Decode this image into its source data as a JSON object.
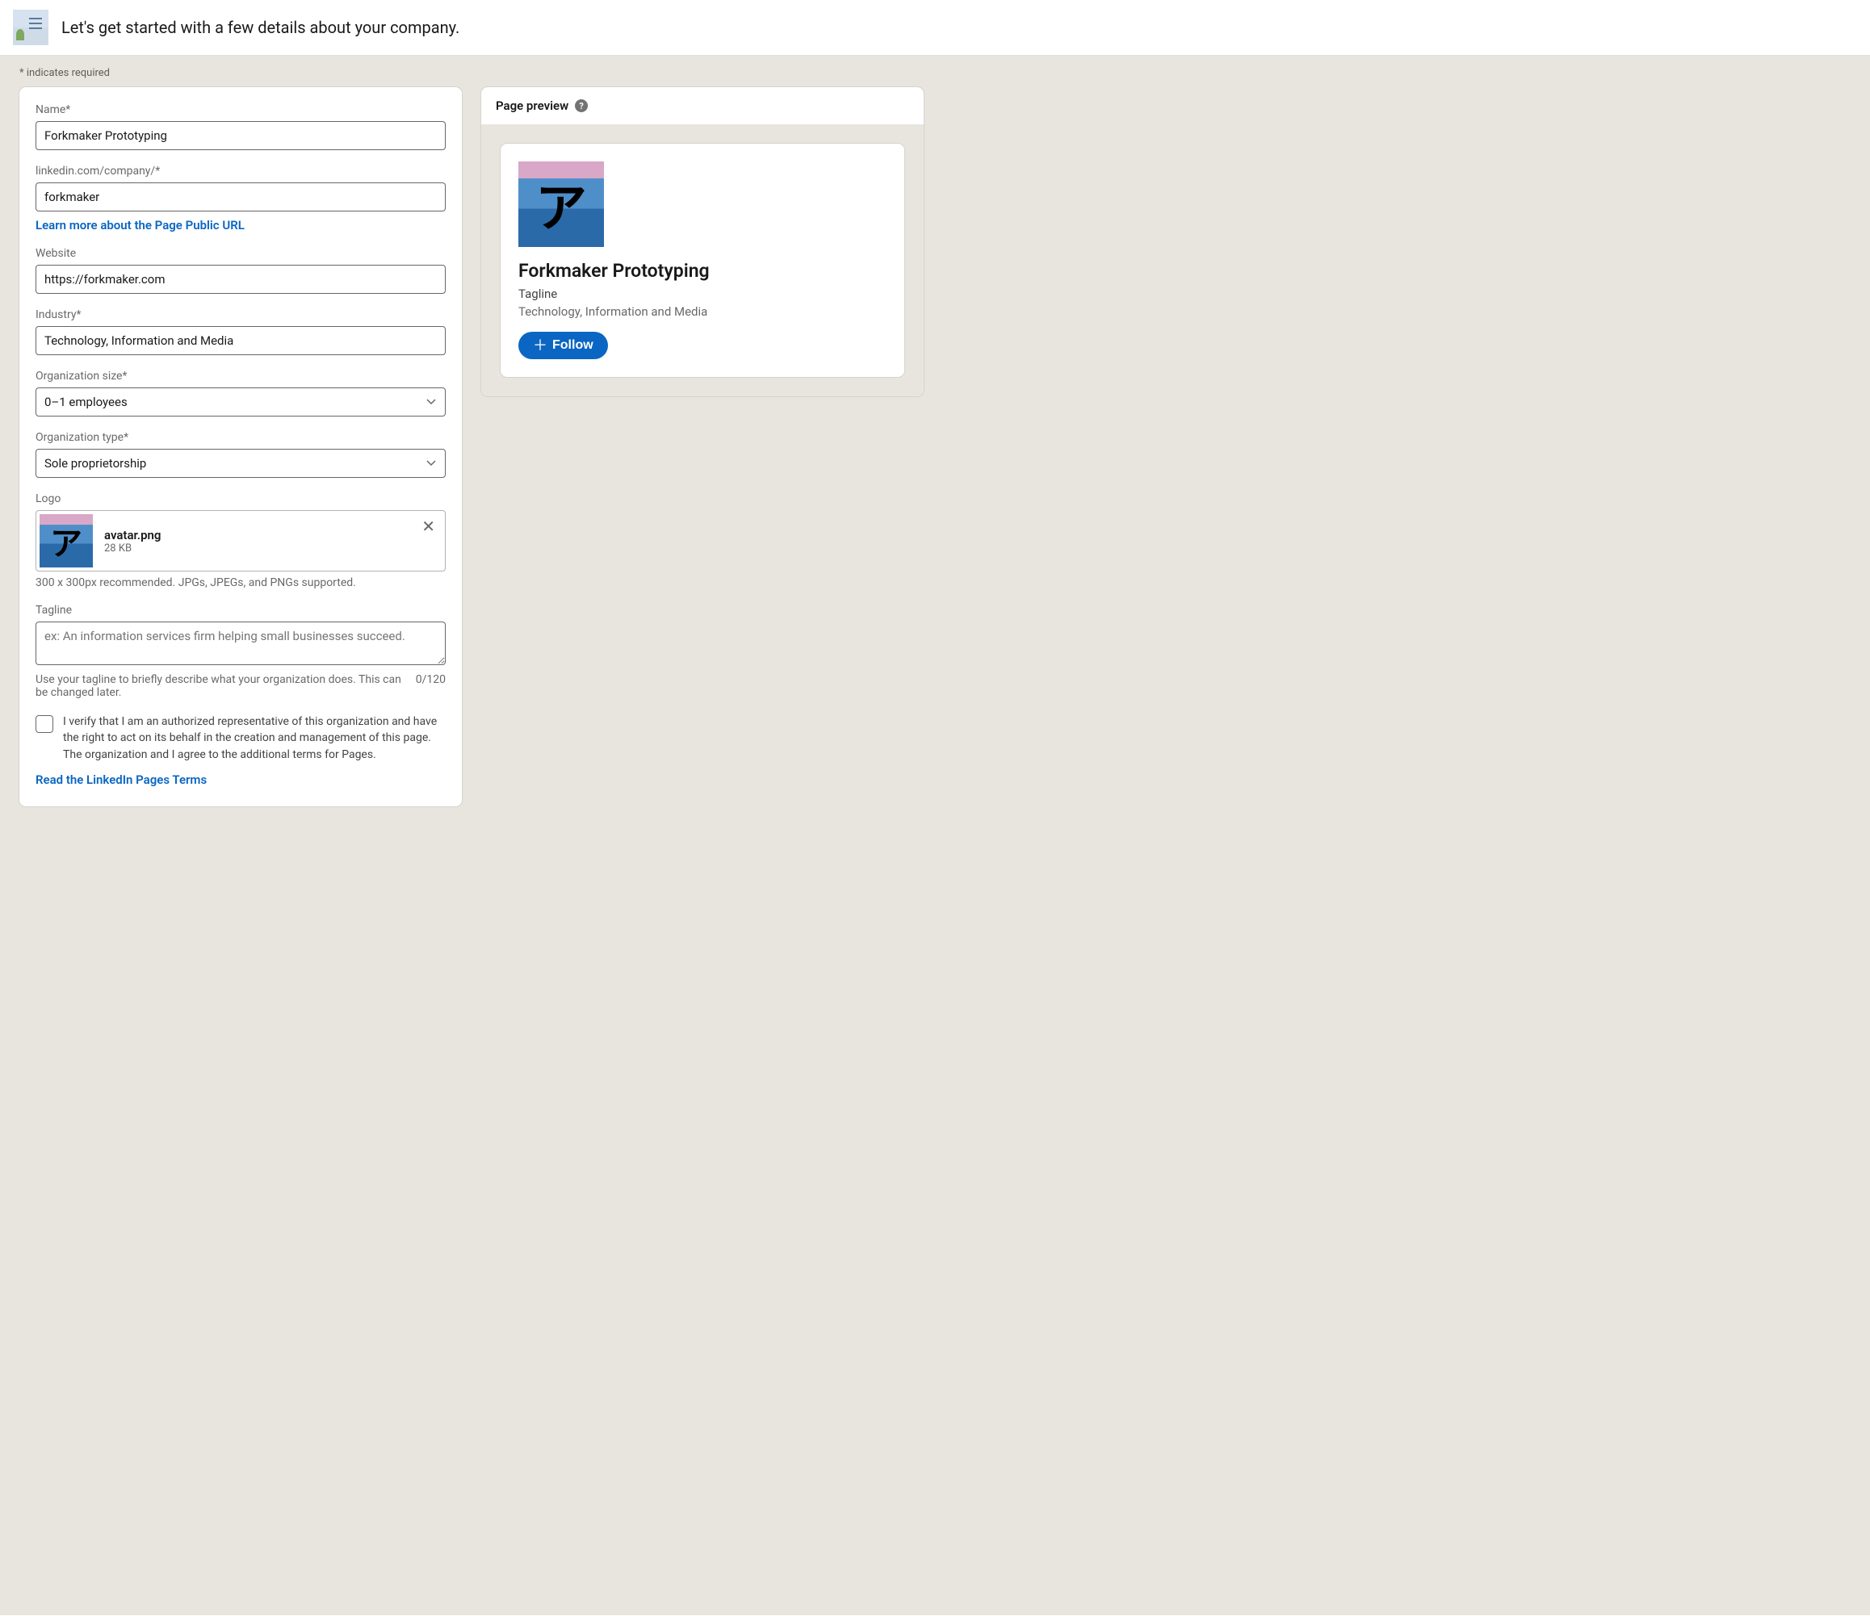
{
  "header": {
    "title": "Let's get started with a few details about your company."
  },
  "required_note": "*  indicates required",
  "form": {
    "name": {
      "label": "Name*",
      "value": "Forkmaker Prototyping"
    },
    "url": {
      "label": "linkedin.com/company/*",
      "value": "forkmaker",
      "learn_more": "Learn more about the Page Public URL"
    },
    "website": {
      "label": "Website",
      "value": "https://forkmaker.com"
    },
    "industry": {
      "label": "Industry*",
      "value": "Technology, Information and Media"
    },
    "org_size": {
      "label": "Organization size*",
      "value": "0–1 employees"
    },
    "org_type": {
      "label": "Organization type*",
      "value": "Sole proprietorship"
    },
    "logo": {
      "label": "Logo",
      "filename": "avatar.png",
      "filesize": "28 KB",
      "help": "300 x 300px recommended. JPGs, JPEGs, and PNGs supported."
    },
    "tagline": {
      "label": "Tagline",
      "placeholder": "ex: An information services firm helping small businesses succeed.",
      "help": "Use your tagline to briefly describe what your organization does. This can be changed later.",
      "count": "0/120"
    },
    "verify": {
      "text": "I verify that I am an authorized representative of this organization and have the right to act on its behalf in the creation and management of this page. The organization and I agree to the additional terms for Pages."
    },
    "terms_link": "Read the LinkedIn Pages Terms"
  },
  "preview": {
    "header": "Page preview",
    "name": "Forkmaker Prototyping",
    "tagline": "Tagline",
    "industry": "Technology, Information and Media",
    "follow": "Follow"
  }
}
